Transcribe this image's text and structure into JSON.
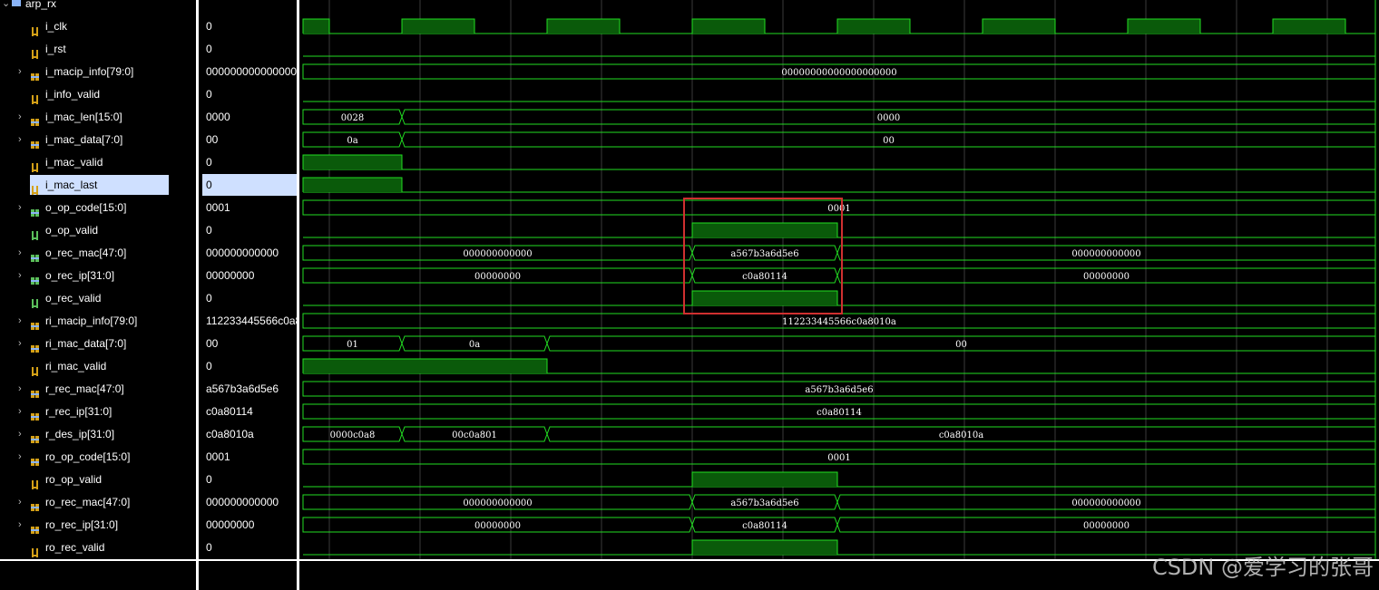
{
  "scope_title": "arp_rx",
  "signals": [
    {
      "name": "i_clk",
      "value": "0",
      "bus": false,
      "kind": "in"
    },
    {
      "name": "i_rst",
      "value": "0",
      "bus": false,
      "kind": "in"
    },
    {
      "name": "i_macip_info[79:0]",
      "value": "00000000000000000000",
      "bus": true,
      "kind": "in"
    },
    {
      "name": "i_info_valid",
      "value": "0",
      "bus": false,
      "kind": "in"
    },
    {
      "name": "i_mac_len[15:0]",
      "value": "0000",
      "bus": true,
      "kind": "in"
    },
    {
      "name": "i_mac_data[7:0]",
      "value": "00",
      "bus": true,
      "kind": "in"
    },
    {
      "name": "i_mac_valid",
      "value": "0",
      "bus": false,
      "kind": "in"
    },
    {
      "name": "i_mac_last",
      "value": "0",
      "bus": false,
      "kind": "in",
      "selected": true
    },
    {
      "name": "o_op_code[15:0]",
      "value": "0001",
      "bus": true,
      "kind": "out"
    },
    {
      "name": "o_op_valid",
      "value": "0",
      "bus": false,
      "kind": "out"
    },
    {
      "name": "o_rec_mac[47:0]",
      "value": "000000000000",
      "bus": true,
      "kind": "out"
    },
    {
      "name": "o_rec_ip[31:0]",
      "value": "00000000",
      "bus": true,
      "kind": "out"
    },
    {
      "name": "o_rec_valid",
      "value": "0",
      "bus": false,
      "kind": "out"
    },
    {
      "name": "ri_macip_info[79:0]",
      "value": "112233445566c0a8010a",
      "bus": true,
      "kind": "reg"
    },
    {
      "name": "ri_mac_data[7:0]",
      "value": "00",
      "bus": true,
      "kind": "reg"
    },
    {
      "name": "ri_mac_valid",
      "value": "0",
      "bus": false,
      "kind": "reg"
    },
    {
      "name": "r_rec_mac[47:0]",
      "value": "a567b3a6d5e6",
      "bus": true,
      "kind": "reg"
    },
    {
      "name": "r_rec_ip[31:0]",
      "value": "c0a80114",
      "bus": true,
      "kind": "reg"
    },
    {
      "name": "r_des_ip[31:0]",
      "value": "c0a8010a",
      "bus": true,
      "kind": "reg"
    },
    {
      "name": "ro_op_code[15:0]",
      "value": "0001",
      "bus": true,
      "kind": "reg"
    },
    {
      "name": "ro_op_valid",
      "value": "0",
      "bus": false,
      "kind": "reg"
    },
    {
      "name": "ro_rec_mac[47:0]",
      "value": "000000000000",
      "bus": true,
      "kind": "reg"
    },
    {
      "name": "ro_rec_ip[31:0]",
      "value": "00000000",
      "bus": true,
      "kind": "reg"
    },
    {
      "name": "ro_rec_valid",
      "value": "0",
      "bus": false,
      "kind": "reg"
    }
  ],
  "bus_segments": {
    "i_macip_info[79:0]": [
      "00000000000000000000"
    ],
    "i_mac_len[15:0]": [
      "0028",
      "0000"
    ],
    "i_mac_data[7:0]": [
      "0a",
      "00"
    ],
    "o_op_code[15:0]": [
      "0001"
    ],
    "o_rec_mac[47:0]": [
      "000000000000",
      "a567b3a6d5e6",
      "000000000000"
    ],
    "o_rec_ip[31:0]": [
      "00000000",
      "c0a80114",
      "00000000"
    ],
    "ri_macip_info[79:0]": [
      "112233445566c0a8010a"
    ],
    "ri_mac_data[7:0]": [
      "01",
      "0a",
      "00"
    ],
    "r_rec_mac[47:0]": [
      "a567b3a6d5e6"
    ],
    "r_rec_ip[31:0]": [
      "c0a80114"
    ],
    "r_des_ip[31:0]": [
      "0000c0a8",
      "00c0a801",
      "c0a8010a"
    ],
    "ro_op_code[15:0]": [
      "0001"
    ],
    "ro_rec_mac[47:0]": [
      "000000000000",
      "a567b3a6d5e6",
      "000000000000"
    ],
    "ro_rec_ip[31:0]": [
      "00000000",
      "c0a80114",
      "00000000"
    ]
  },
  "colors": {
    "wave_line": "#22dd22",
    "wave_fill": "#0a5a0a",
    "grid": "#3a3a3a",
    "highlight_box": "#d03030",
    "selection": "#cfe0ff",
    "icon_in": "#d4a017",
    "icon_out": "#5bbf5b",
    "icon_reg": "#d4a017"
  },
  "watermark": "CSDN @爱学习的张哥"
}
